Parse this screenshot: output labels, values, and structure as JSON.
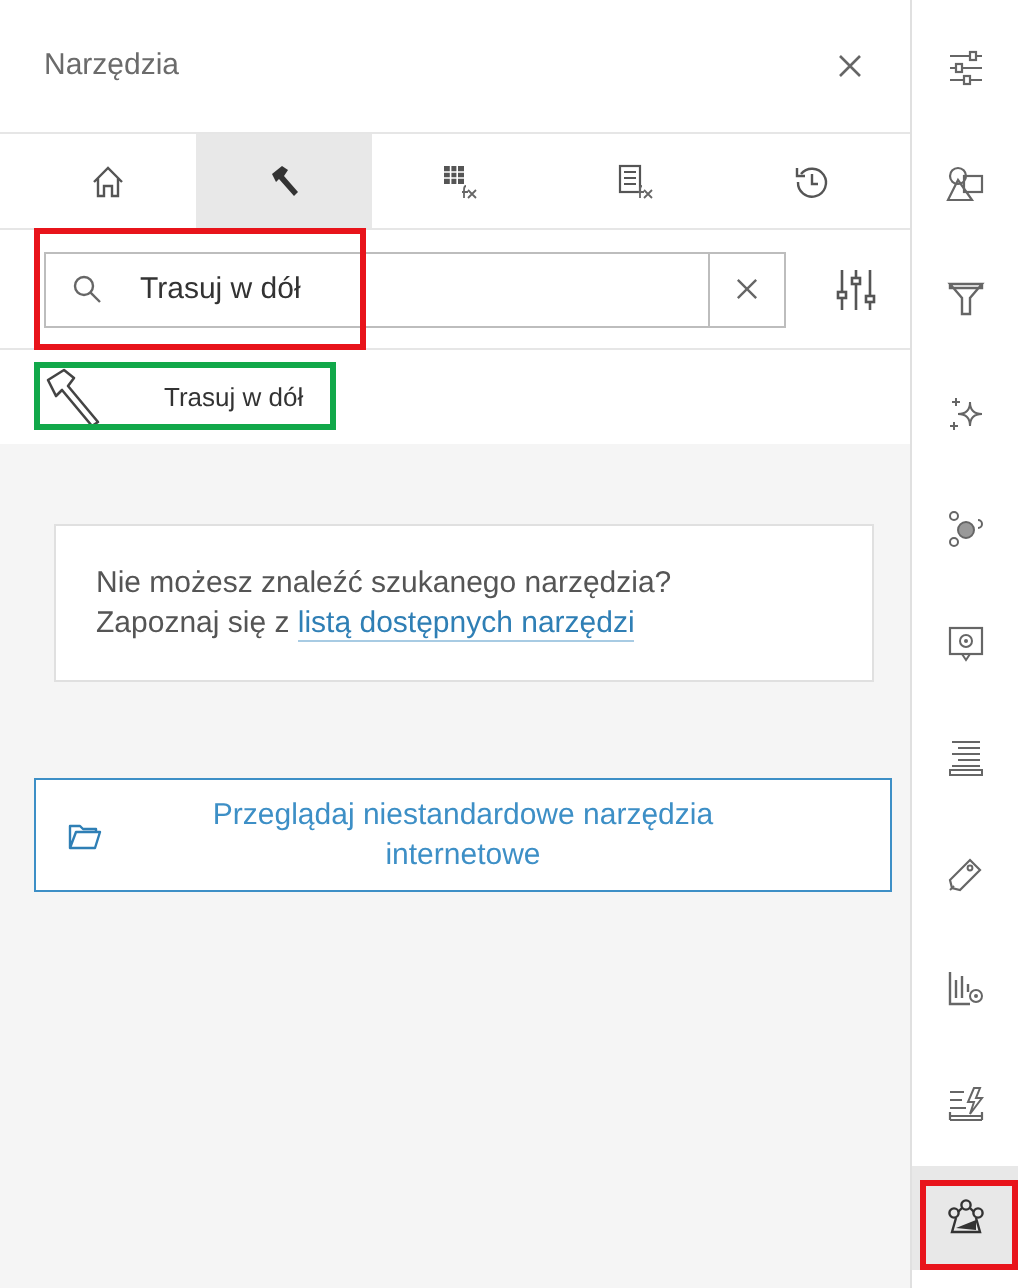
{
  "panel": {
    "title": "Narzędzia"
  },
  "tabs": [
    {
      "selected": false
    },
    {
      "selected": true
    },
    {
      "selected": false
    },
    {
      "selected": false
    },
    {
      "selected": false
    }
  ],
  "search": {
    "value": "Trasuj w dół"
  },
  "results": [
    {
      "label": "Trasuj w dół"
    }
  ],
  "notice": {
    "text": "Nie możesz znaleźć szukanego narzędzia? Zapoznaj się z",
    "link": "listą dostępnych narzędzi"
  },
  "browse_button": {
    "label": "Przeglądaj niestandardowe narzędzia internetowe"
  },
  "rail": [
    {
      "selected": false
    },
    {
      "selected": false
    },
    {
      "selected": false
    },
    {
      "selected": false
    },
    {
      "selected": false
    },
    {
      "selected": false
    },
    {
      "selected": false
    },
    {
      "selected": false
    },
    {
      "selected": false
    },
    {
      "selected": false
    },
    {
      "selected": true
    }
  ]
}
